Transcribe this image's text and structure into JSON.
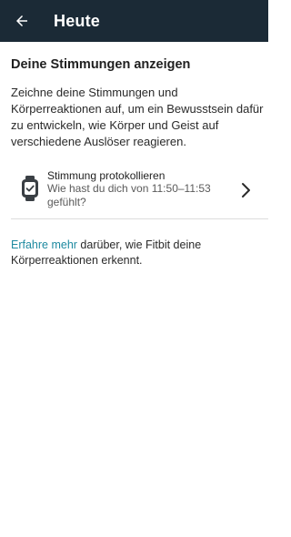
{
  "header": {
    "title": "Heute"
  },
  "section": {
    "title": "Deine Stimmungen anzeigen",
    "description": "Zeichne deine Stimmungen und Körperreaktionen auf, um ein Bewusstsein dafür zu entwickeln, wie Körper und Geist auf verschiedene Auslöser reagieren."
  },
  "log_item": {
    "icon": "watch-icon",
    "title": "Stimmung protokollieren",
    "subtitle": "Wie hast du dich von 11:50–11:53 gefühlt?"
  },
  "learn_more": {
    "link_text": "Erfahre mehr",
    "rest_text": " darüber, wie Fitbit deine Körperreaktionen erkennt."
  },
  "colors": {
    "app_bar": "#1b2a36",
    "link": "#1e8aa0",
    "divider": "#dcdcdc"
  }
}
